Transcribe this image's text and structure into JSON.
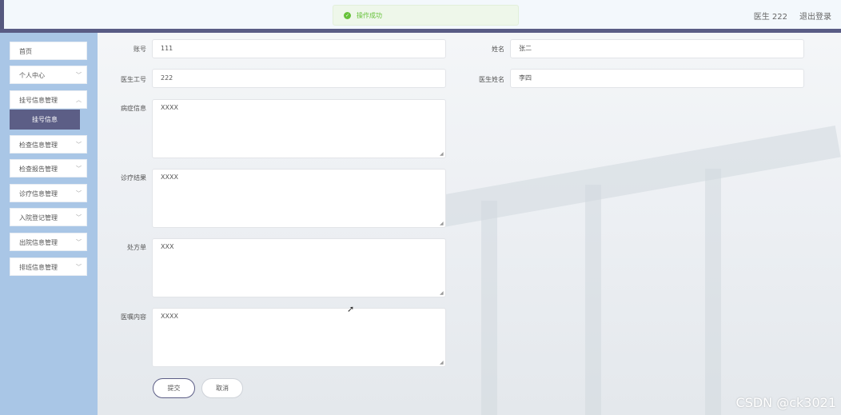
{
  "header": {
    "toast": "操作成功",
    "user_label": "医生 222",
    "logout": "退出登录"
  },
  "sidebar": {
    "items": [
      {
        "label": "首页",
        "has_arrow": false
      },
      {
        "label": "个人中心",
        "has_arrow": true
      },
      {
        "label": "挂号信息管理",
        "has_arrow": true
      },
      {
        "label": "检查信息管理",
        "has_arrow": true
      },
      {
        "label": "检查报告管理",
        "has_arrow": true
      },
      {
        "label": "诊疗信息管理",
        "has_arrow": true
      },
      {
        "label": "入院登记管理",
        "has_arrow": true
      },
      {
        "label": "出院信息管理",
        "has_arrow": true
      },
      {
        "label": "排班信息管理",
        "has_arrow": true
      }
    ],
    "active_submenu": "挂号信息"
  },
  "form": {
    "account_label": "账号",
    "account_value": "111",
    "name_label": "姓名",
    "name_value": "张二",
    "doctor_id_label": "医生工号",
    "doctor_id_value": "222",
    "doctor_name_label": "医生姓名",
    "doctor_name_value": "李四",
    "symptom_label": "病症信息",
    "symptom_value": "XXXX",
    "result_label": "诊疗结果",
    "result_value": "XXXX",
    "prescription_label": "处方单",
    "prescription_value": "XXX",
    "advice_label": "医嘱内容",
    "advice_value": "XXXX",
    "submit": "提交",
    "cancel": "取消"
  },
  "watermark": "CSDN @ck3021"
}
